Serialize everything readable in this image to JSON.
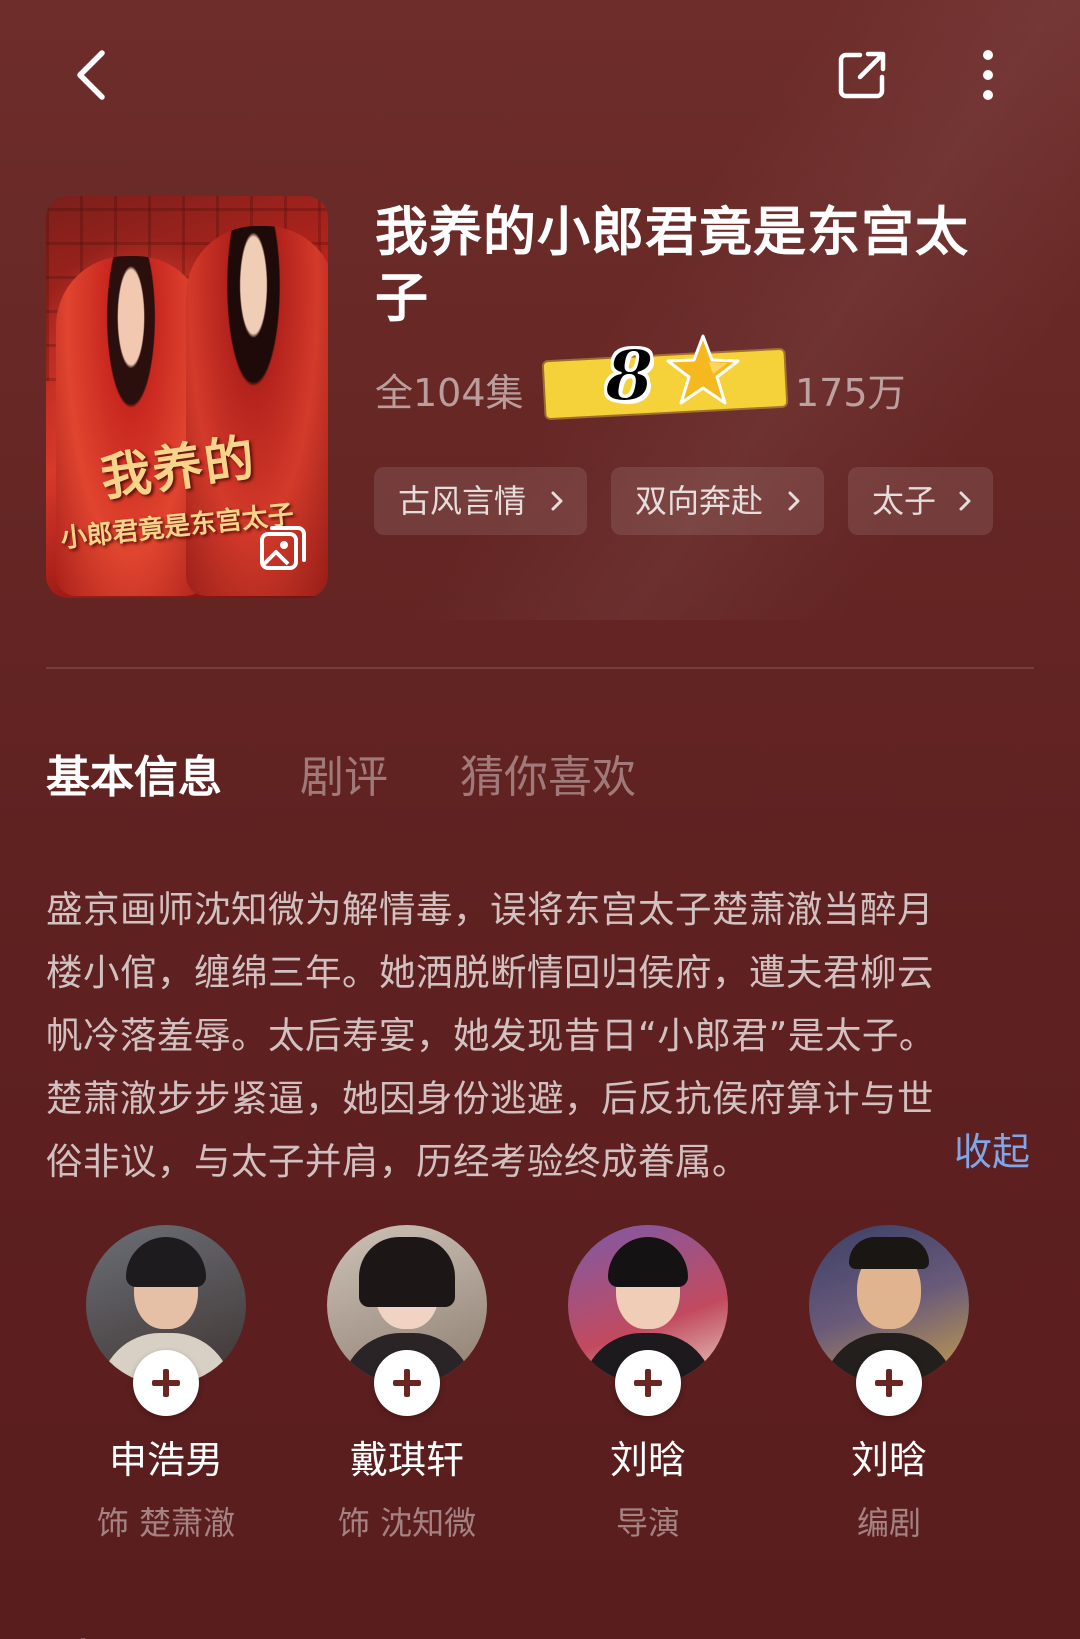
{
  "header": {
    "title": "我养的小郎君竟是东宫太子",
    "episodes": "全104集",
    "views": "175万",
    "score": "8",
    "tags": [
      {
        "label": "古风言情"
      },
      {
        "label": "双向奔赴"
      },
      {
        "label": "太子"
      }
    ],
    "poster": {
      "title_line1": "我养的",
      "title_line2": "小郎君竟是东宫太子"
    }
  },
  "tabs": [
    {
      "label": "基本信息",
      "active": true
    },
    {
      "label": "剧评",
      "active": false
    },
    {
      "label": "猜你喜欢",
      "active": false
    }
  ],
  "synopsis": {
    "lines": [
      "盛京画师沈知微为解情毒，误将东宫太子楚萧澈当醉月",
      "楼小倌，缠绵三年。她洒脱断情回归侯府，遭夫君柳云",
      "帆冷落羞辱。太后寿宴，她发现昔日“小郎君”是太子。",
      "楚萧澈步步紧逼，她因身份逃避，后反抗侯府算计与世",
      "俗非议，与太子并肩，历经考验终成眷属。"
    ],
    "collapse_label": "收起"
  },
  "cast": [
    {
      "name": "申浩男",
      "role": "饰 楚萧澈"
    },
    {
      "name": "戴琪轩",
      "role": "饰 沈知微"
    },
    {
      "name": "刘晗",
      "role": "导演"
    },
    {
      "name": "刘晗",
      "role": "编剧"
    }
  ],
  "next_section_label": "剧评",
  "colors": {
    "background": "#652624",
    "link": "#7fa6e8",
    "sticker": "#f5d23a"
  },
  "icons": [
    "back-icon",
    "share-icon",
    "more-icon",
    "gallery-icon",
    "star-icon",
    "chevron-right-icon",
    "plus-icon"
  ]
}
